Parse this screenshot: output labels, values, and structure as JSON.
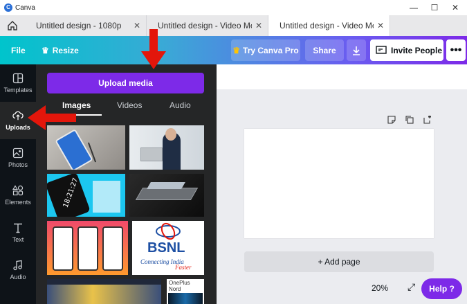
{
  "window": {
    "app_title": "Canva",
    "minimize_glyph": "—",
    "maximize_glyph": "☐",
    "close_glyph": "✕"
  },
  "tabs": [
    {
      "label": "Untitled design - 1080p",
      "close": "✕"
    },
    {
      "label": "Untitled design - Video Mess",
      "close": "✕"
    },
    {
      "label": "Untitled design - Video Mess",
      "close": "✕"
    }
  ],
  "toolbar": {
    "file": "File",
    "resize": "Resize",
    "try_pro": "Try Canva Pro",
    "share": "Share",
    "invite": "Invite People",
    "more": "•••"
  },
  "rail": [
    {
      "label": "Templates",
      "icon": "templates-icon"
    },
    {
      "label": "Uploads",
      "icon": "upload-cloud-icon"
    },
    {
      "label": "Photos",
      "icon": "photos-icon"
    },
    {
      "label": "Elements",
      "icon": "elements-icon"
    },
    {
      "label": "Text",
      "icon": "text-icon"
    },
    {
      "label": "Audio",
      "icon": "audio-icon"
    }
  ],
  "panel": {
    "upload_button": "Upload media",
    "tabs": [
      "Images",
      "Videos",
      "Audio"
    ],
    "thumb_texts": {
      "clock": "18:21:27",
      "bsnl": "BSNL",
      "bsnl_tagline": "Connecting India",
      "bsnl_faster": "Faster",
      "oneplus": "OnePlus Nord"
    }
  },
  "canvas": {
    "add_page": "+ Add page",
    "zoom": "20%",
    "help": "Help ?"
  },
  "colors": {
    "accent": "#7d2ae8",
    "teal": "#00c4cc",
    "dark_rail": "#0e1318",
    "panel": "#252627",
    "arrow": "#e3160b"
  }
}
